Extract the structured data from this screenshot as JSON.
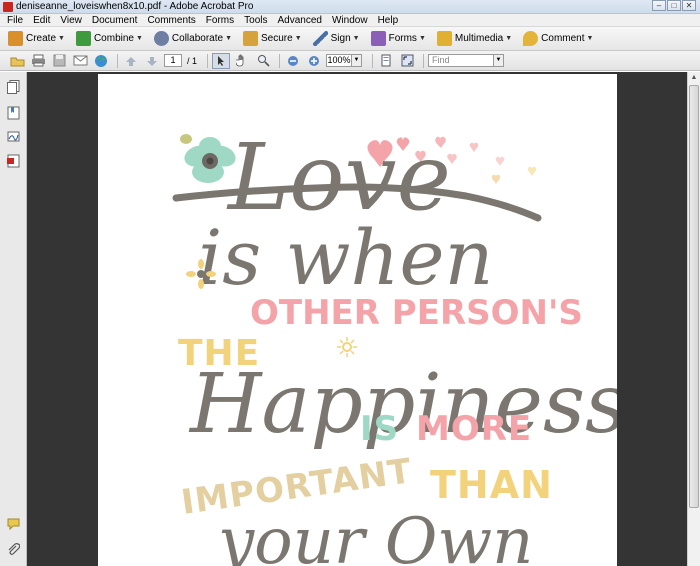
{
  "window": {
    "title": "deniseanne_loveiswhen8x10.pdf - Adobe Acrobat Pro",
    "controls": {
      "minimize": "–",
      "maximize": "□",
      "close": "✕"
    }
  },
  "menu": [
    "File",
    "Edit",
    "View",
    "Document",
    "Comments",
    "Forms",
    "Tools",
    "Advanced",
    "Window",
    "Help"
  ],
  "tasks": [
    {
      "label": "Create",
      "icon": "create-pdf-icon",
      "color": "#d9902a"
    },
    {
      "label": "Combine",
      "icon": "combine-files-icon",
      "color": "#3d9a3d"
    },
    {
      "label": "Collaborate",
      "icon": "collaborate-icon",
      "color": "#6f7ea3"
    },
    {
      "label": "Secure",
      "icon": "lock-icon",
      "color": "#d6a23c"
    },
    {
      "label": "Sign",
      "icon": "pen-icon",
      "color": "#4a6fa8"
    },
    {
      "label": "Forms",
      "icon": "forms-icon",
      "color": "#8b5fb8"
    },
    {
      "label": "Multimedia",
      "icon": "multimedia-icon",
      "color": "#e0b030"
    },
    {
      "label": "Comment",
      "icon": "comment-icon",
      "color": "#e3b43a"
    }
  ],
  "nav": {
    "current_page": "1",
    "total_pages": "/ 1",
    "zoom": "100%",
    "find_placeholder": "Find"
  },
  "artwork": {
    "line1": "Love",
    "line2": "is when",
    "line3a": "THE",
    "line3b": "OTHER PERSON'S",
    "line4": "Happiness",
    "line5a": "IS",
    "line5b": "MORE",
    "line6a": "IMPORTANT",
    "line6b": "THAN",
    "line7": "your Own",
    "colors": {
      "script": "#7b7770",
      "pink": "#f4a3a8",
      "yellow": "#f2d27a",
      "mint": "#9fd9c6",
      "tan": "#e3cfa0"
    }
  }
}
